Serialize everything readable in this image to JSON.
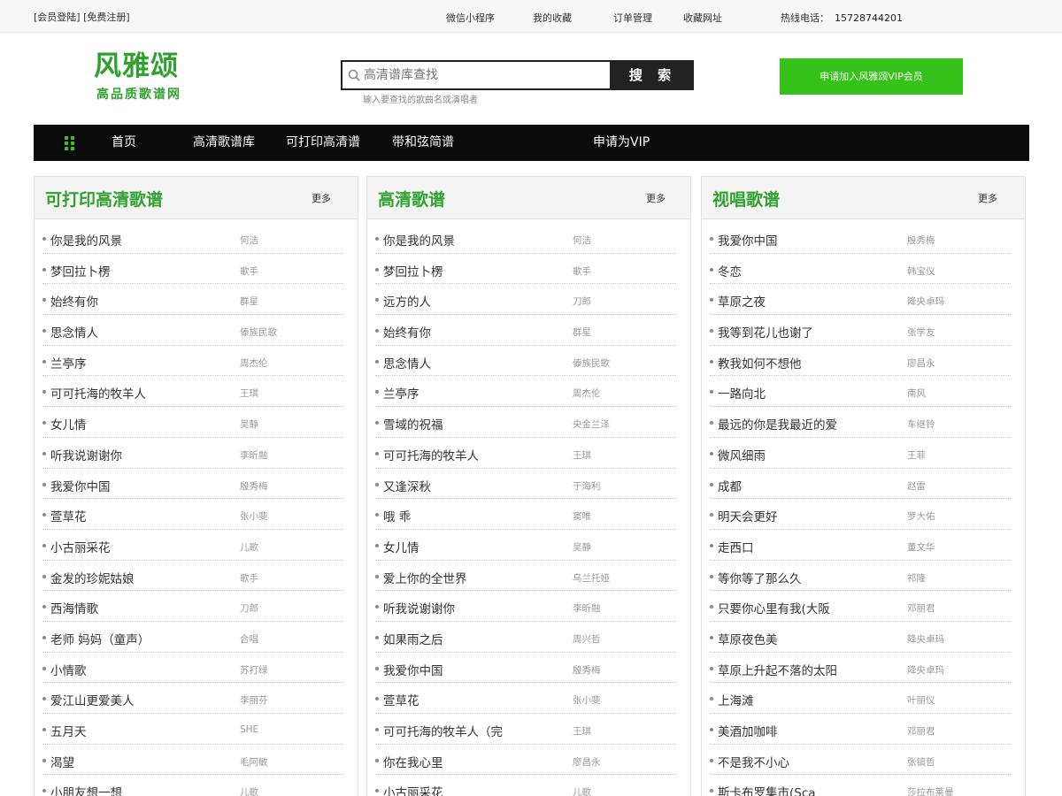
{
  "topbar": {
    "login": "[会员登陆]",
    "register": "[免费注册]",
    "links": [
      "微信小程序",
      "我的收藏",
      "订单管理",
      "收藏网址"
    ],
    "hotline_label": "热线电话：",
    "hotline_number": "15728744201"
  },
  "logo": {
    "title": "风雅颂",
    "subtitle": "高品质歌谱网"
  },
  "search": {
    "placeholder": "高清谱库查找",
    "button": "搜 索",
    "hint": "输入要查找的歌曲名或演唱者"
  },
  "vip_button": "申请加入风雅颂VIP会员",
  "nav": [
    "首页",
    "高清歌谱库",
    "可打印高清谱",
    "带和弦简谱",
    "申请为VIP"
  ],
  "columns": [
    {
      "title": "可打印高清歌谱",
      "more": "更多",
      "items": [
        {
          "song": "你是我的风景",
          "artist": "何洁"
        },
        {
          "song": "梦回拉卜楞",
          "artist": "歌手"
        },
        {
          "song": "始终有你",
          "artist": "群星"
        },
        {
          "song": "思念情人",
          "artist": "傣族民歌"
        },
        {
          "song": "兰亭序",
          "artist": "周杰伦"
        },
        {
          "song": "可可托海的牧羊人",
          "artist": "王琪"
        },
        {
          "song": "女儿情",
          "artist": "吴静"
        },
        {
          "song": "听我说谢谢你",
          "artist": "李昕融"
        },
        {
          "song": "我爱你中国",
          "artist": "殷秀梅"
        },
        {
          "song": "萱草花",
          "artist": "张小斐"
        },
        {
          "song": "小古丽采花",
          "artist": "儿歌"
        },
        {
          "song": "金发的珍妮姑娘",
          "artist": "歌手"
        },
        {
          "song": "西海情歌",
          "artist": "刀郎"
        },
        {
          "song": "老师 妈妈（童声）",
          "artist": "合唱"
        },
        {
          "song": "小情歌",
          "artist": "苏打绿"
        },
        {
          "song": "爱江山更爱美人",
          "artist": "李丽芬"
        },
        {
          "song": "五月天",
          "artist": "SHE"
        },
        {
          "song": "渴望",
          "artist": "毛阿敏"
        },
        {
          "song": "小朋友想一想",
          "artist": "儿歌"
        }
      ]
    },
    {
      "title": "高清歌谱",
      "more": "更多",
      "items": [
        {
          "song": "你是我的风景",
          "artist": "何洁"
        },
        {
          "song": "梦回拉卜楞",
          "artist": "歌手"
        },
        {
          "song": "远方的人",
          "artist": "刀郎"
        },
        {
          "song": "始终有你",
          "artist": "群星"
        },
        {
          "song": "思念情人",
          "artist": "傣族民歌"
        },
        {
          "song": "兰亭序",
          "artist": "周杰伦"
        },
        {
          "song": "雪域的祝福",
          "artist": "央金兰泽"
        },
        {
          "song": "可可托海的牧羊人",
          "artist": "王琪"
        },
        {
          "song": "又逢深秋",
          "artist": "于海利"
        },
        {
          "song": "哦 乖",
          "artist": "窦唯"
        },
        {
          "song": "女儿情",
          "artist": "吴静"
        },
        {
          "song": "爱上你的全世界",
          "artist": "乌兰托娅"
        },
        {
          "song": "听我说谢谢你",
          "artist": "李昕融"
        },
        {
          "song": "如果雨之后",
          "artist": "周兴哲"
        },
        {
          "song": "我爱你中国",
          "artist": "殷秀梅"
        },
        {
          "song": "萱草花",
          "artist": "张小斐"
        },
        {
          "song": "可可托海的牧羊人（完",
          "artist": "王琪"
        },
        {
          "song": "你在我心里",
          "artist": "廖昌永"
        },
        {
          "song": "小古丽采花",
          "artist": "儿歌"
        }
      ]
    },
    {
      "title": "视唱歌谱",
      "more": "更多",
      "items": [
        {
          "song": "我爱你中国",
          "artist": "殷秀梅"
        },
        {
          "song": "冬恋",
          "artist": "韩宝仪"
        },
        {
          "song": "草原之夜",
          "artist": "降央卓玛"
        },
        {
          "song": "我等到花儿也谢了",
          "artist": "张学友"
        },
        {
          "song": "教我如何不想他",
          "artist": "廖昌永"
        },
        {
          "song": "一路向北",
          "artist": "南风"
        },
        {
          "song": "最远的你是我最近的爱",
          "artist": "车继铃"
        },
        {
          "song": "微风细雨",
          "artist": "王菲"
        },
        {
          "song": "成都",
          "artist": "赵雷"
        },
        {
          "song": "明天会更好",
          "artist": "罗大佑"
        },
        {
          "song": "走西口",
          "artist": "董文华"
        },
        {
          "song": "等你等了那么久",
          "artist": "祁隆"
        },
        {
          "song": "只要你心里有我(大阪",
          "artist": "邓丽君"
        },
        {
          "song": "草原夜色美",
          "artist": "降央卓玛"
        },
        {
          "song": "草原上升起不落的太阳",
          "artist": "降央卓玛"
        },
        {
          "song": "上海滩",
          "artist": "叶丽仪"
        },
        {
          "song": "美酒加咖啡",
          "artist": "邓丽君"
        },
        {
          "song": "不是我不小心",
          "artist": "张镐哲"
        },
        {
          "song": "斯卡布罗集市(Sca",
          "artist": "莎拉布莱曼"
        }
      ]
    }
  ],
  "colors": {
    "brand_green": "#2fa12e",
    "vip_green": "#35c31a",
    "nav_bg": "#0b0b0b"
  }
}
